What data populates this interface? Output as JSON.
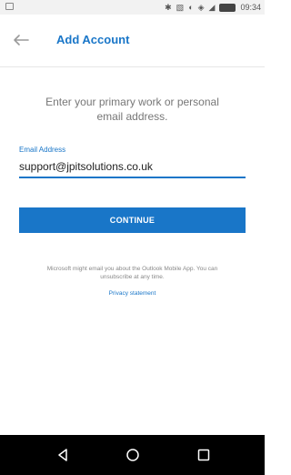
{
  "status_bar": {
    "time": "09:34",
    "icons": [
      "bluetooth-icon",
      "vibrate-icon",
      "data-saver-icon",
      "wifi-icon",
      "signal-icon",
      "battery-icon"
    ]
  },
  "app_bar": {
    "title": "Add Account",
    "back_icon": "back-arrow-icon"
  },
  "main": {
    "prompt": "Enter your primary work or personal email address.",
    "email_label": "Email Address",
    "email_value": "support@jpitsolutions.co.uk",
    "continue_label": "CONTINUE",
    "disclaimer": "Microsoft might email you about the Outlook Mobile App. You can unsubscribe at any time.",
    "privacy_link": "Privacy statement"
  },
  "nav_bar": {
    "buttons": [
      "back-icon",
      "home-icon",
      "recent-apps-icon"
    ]
  },
  "colors": {
    "accent": "#1976c8",
    "nav_bar": "#000000",
    "status_bar": "#f2f2f2"
  }
}
